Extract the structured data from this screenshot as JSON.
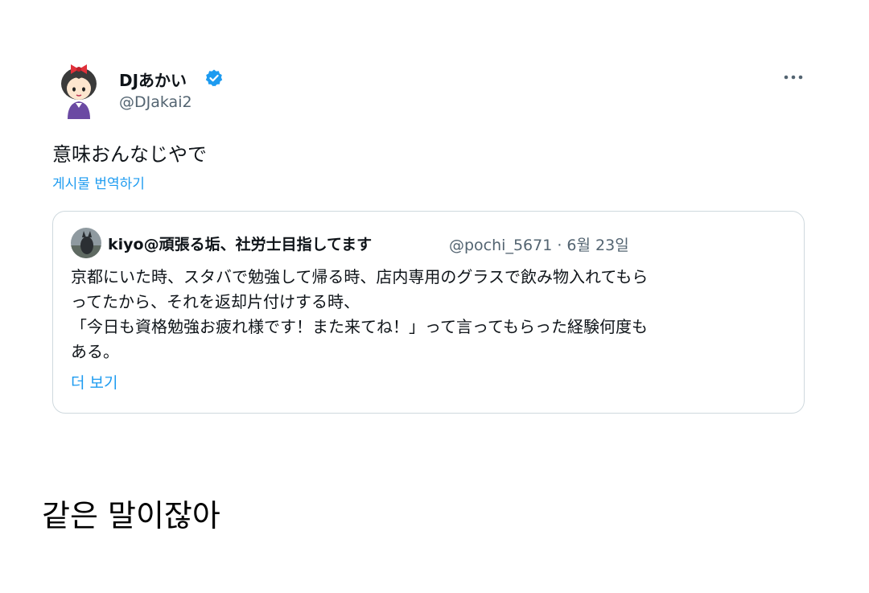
{
  "tweet": {
    "author": {
      "display_name": "DJあかい",
      "handle": "@DJakai2",
      "verified": true,
      "avatar_icon": "avatar-illustration-icon"
    },
    "text": "意味おんなじやで",
    "translate_label": "게시물 번역하기",
    "more_icon": "more-options-icon"
  },
  "quoted_tweet": {
    "author": {
      "display_name": "kiyo@頑張る垢、社労士目指してます",
      "handle": "@pochi_5671",
      "date": "6월 23일",
      "avatar_icon": "avatar-photo-icon"
    },
    "meta_line": "@pochi_5671 · 6월 23일",
    "lines": [
      "京都にいた時、スタバで勉強して帰る時、店内専用のグラスで飲み物入れてもら",
      "ってたから、それを返却片付けする時、",
      "「今日も資格勉強お疲れ様です！また来てね！」って言ってもらった経験何度も",
      "ある。"
    ],
    "show_more_label": "더 보기"
  },
  "caption": "같은 말이잖아",
  "colors": {
    "link": "#1d9bf0",
    "verified": "#1d9bf0",
    "secondary_text": "#536471",
    "border": "#cfd9de"
  }
}
